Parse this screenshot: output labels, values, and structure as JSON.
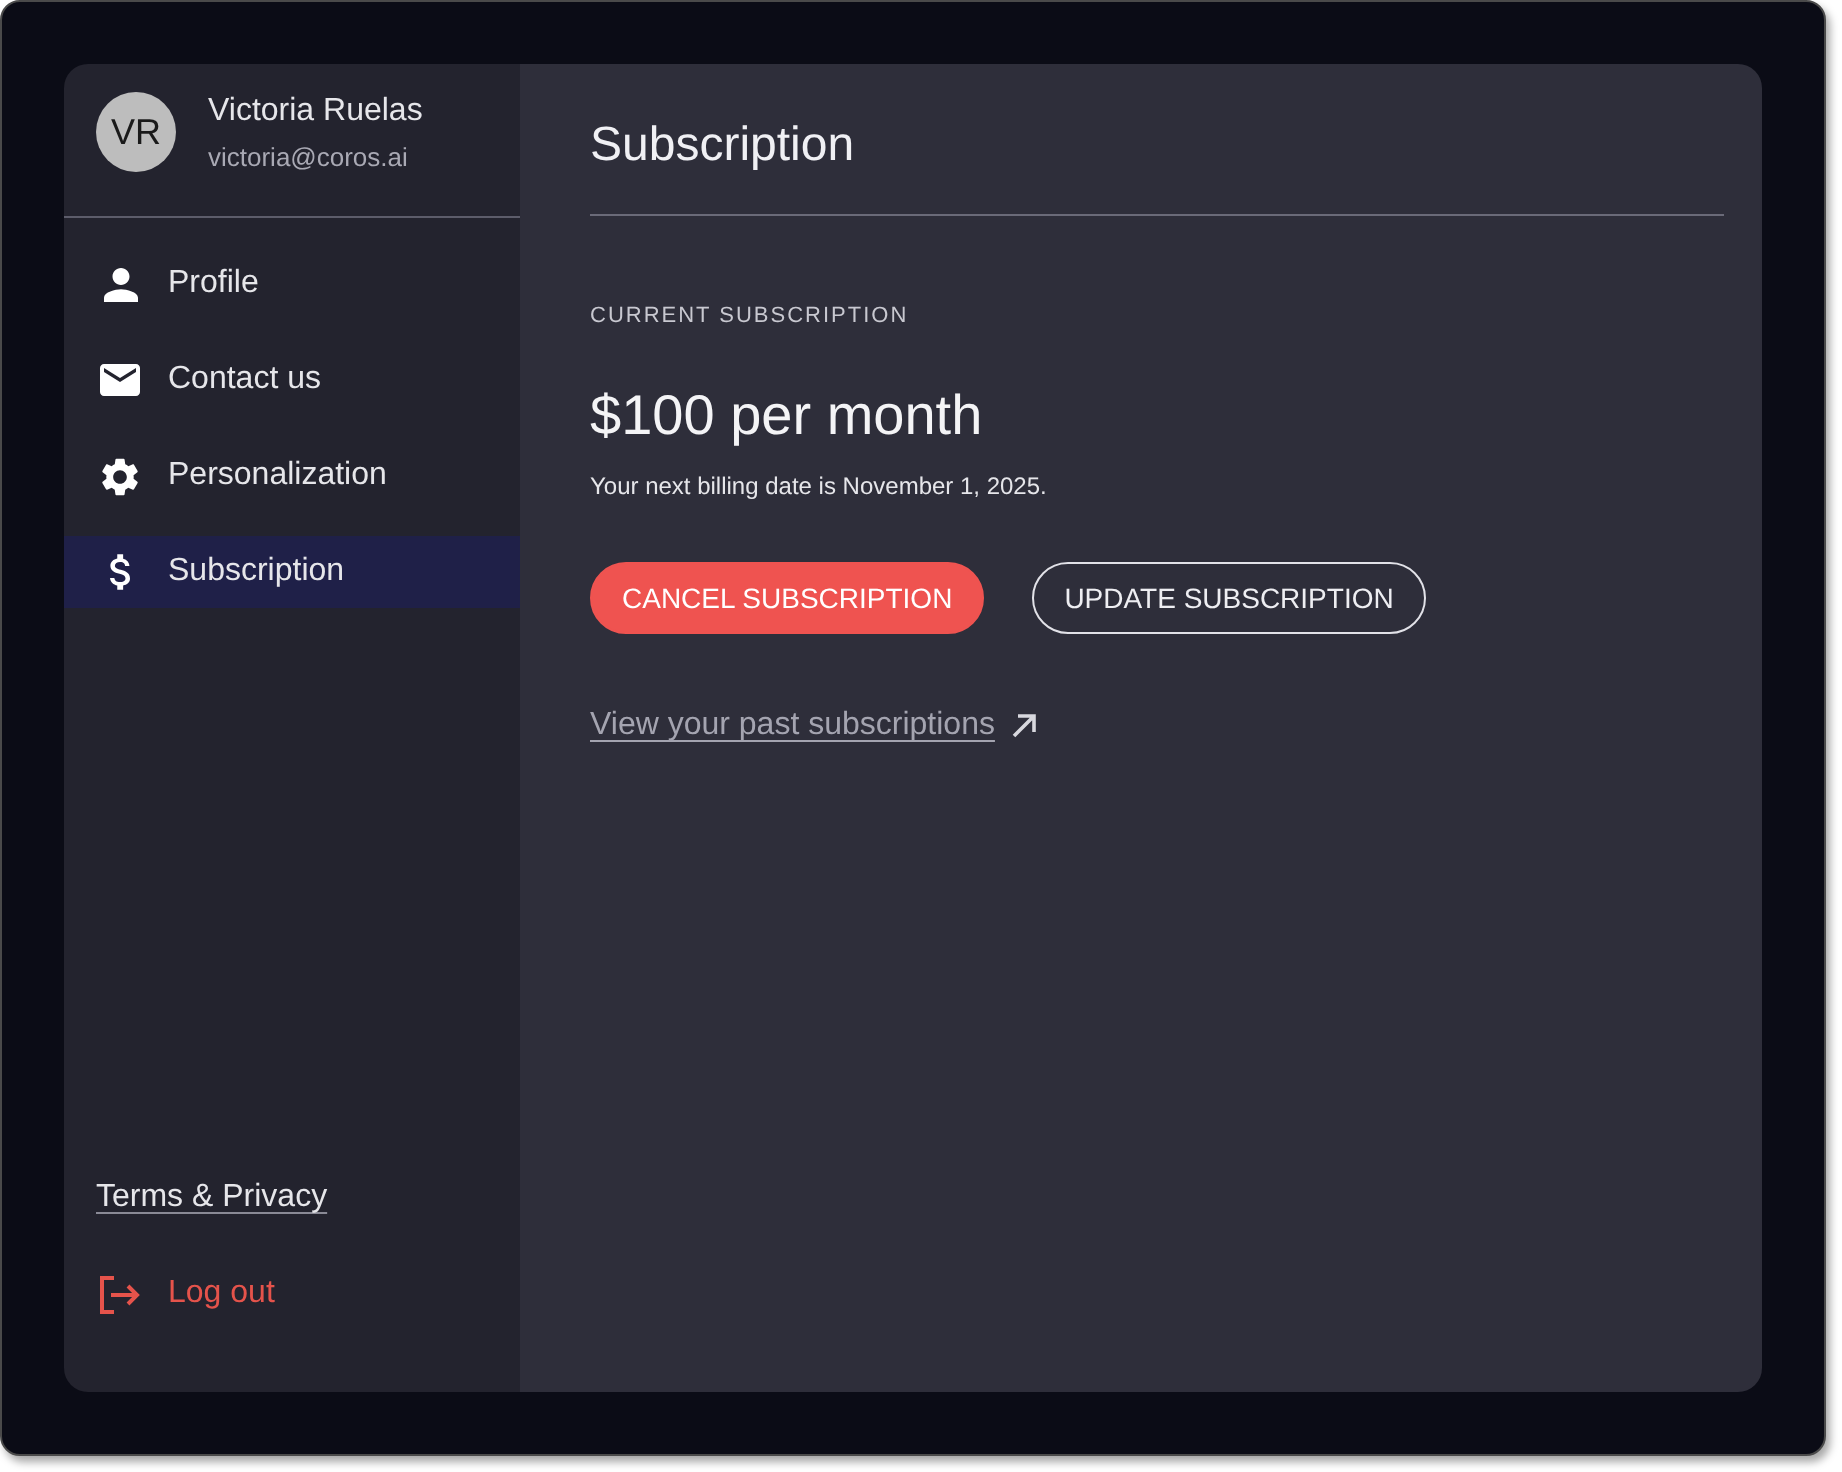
{
  "user": {
    "initials": "VR",
    "name": "Victoria Ruelas",
    "email": "victoria@coros.ai"
  },
  "nav": [
    {
      "label": "Profile",
      "selected": false
    },
    {
      "label": "Contact us",
      "selected": false
    },
    {
      "label": "Personalization",
      "selected": false
    },
    {
      "label": "Subscription",
      "selected": true
    }
  ],
  "footer": {
    "terms_link": "Terms & Privacy",
    "logout": "Log out"
  },
  "page": {
    "title": "Subscription",
    "section_label": "CURRENT SUBSCRIPTION",
    "price": "$100 per month",
    "billing_note": "Your next billing date is November 1, 2025.",
    "buttons": [
      {
        "label": "CANCEL SUBSCRIPTION",
        "kind": "danger"
      },
      {
        "label": "UPDATE SUBSCRIPTION",
        "kind": "outline"
      }
    ],
    "history_link": "View your past subscriptions"
  }
}
